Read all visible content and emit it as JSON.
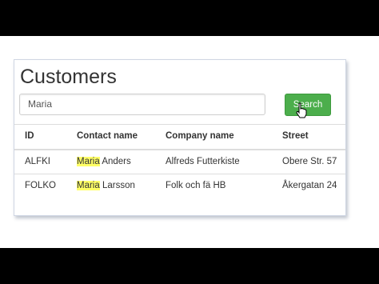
{
  "page": {
    "title": "Customers"
  },
  "search": {
    "value": "Maria",
    "button_label": "Search"
  },
  "table": {
    "columns": [
      "ID",
      "Contact name",
      "Company name",
      "Street"
    ],
    "rows": [
      {
        "id": "ALFKI",
        "contact_match": "Maria",
        "contact_rest": " Anders",
        "company": "Alfreds Futterkiste",
        "street": "Obere Str. 57"
      },
      {
        "id": "FOLKO",
        "contact_match": "Maria",
        "contact_rest": " Larsson",
        "company": "Folk och fä HB",
        "street": "Åkergatan 24"
      }
    ]
  },
  "colors": {
    "button": "#4cae4c",
    "highlight": "#ffff66",
    "letterbox": "#000000"
  }
}
